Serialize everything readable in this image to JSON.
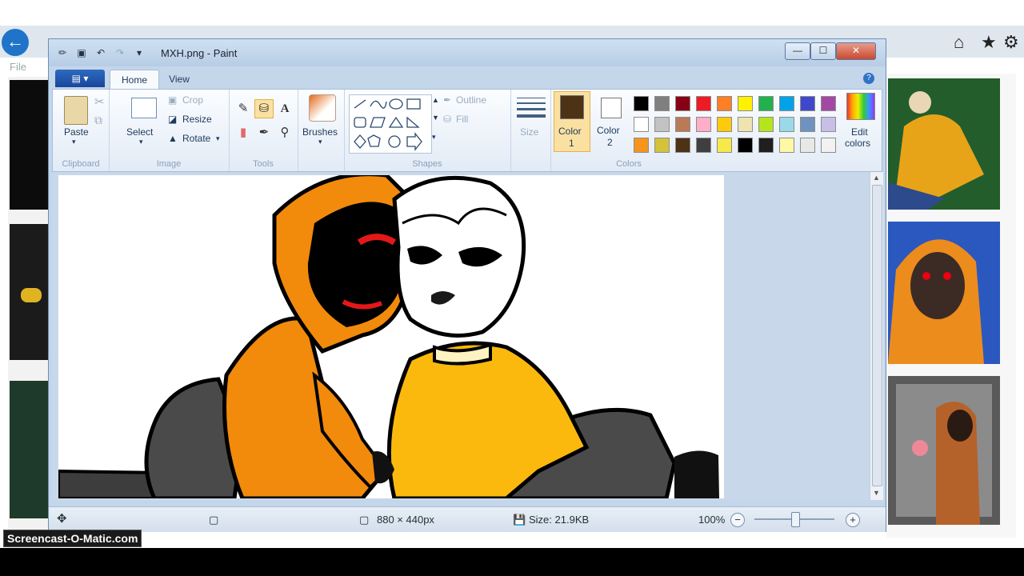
{
  "watermark": "Screencast-O-Matic.com",
  "browser": {
    "file_menu": "File",
    "back_icon": "back-arrow-icon",
    "home_icon": "home-icon",
    "favorites_icon": "star-icon",
    "settings_icon": "gear-icon"
  },
  "window": {
    "title": "MXH.png - Paint",
    "controls": {
      "minimize": "—",
      "maximize": "☐",
      "close": "✕"
    }
  },
  "tabs": [
    {
      "label": "Home",
      "active": true
    },
    {
      "label": "View",
      "active": false
    }
  ],
  "ribbon": {
    "clipboard": {
      "paste": "Paste",
      "group": "Clipboard"
    },
    "image": {
      "select": "Select",
      "crop": "Crop",
      "resize": "Resize",
      "rotate": "Rotate",
      "group": "Image"
    },
    "tools": {
      "group": "Tools"
    },
    "brushes": {
      "label": "Brushes"
    },
    "shapes": {
      "outline": "Outline",
      "fill": "Fill",
      "group": "Shapes"
    },
    "size": {
      "label": "Size"
    },
    "color1": {
      "label": "Color 1",
      "line1": "Color",
      "line2": "1",
      "value": "#4d3216"
    },
    "color2": {
      "label": "Color 2",
      "line1": "Color",
      "line2": "2",
      "value": "#ffffff"
    },
    "colors_group": "Colors",
    "edit_colors": {
      "line1": "Edit",
      "line2": "colors"
    },
    "palette": [
      [
        "#000000",
        "#7f7f7f",
        "#880015",
        "#ed1c24",
        "#ff7f27",
        "#fff200",
        "#22b14c",
        "#00a2e8",
        "#3f48cc",
        "#a349a4"
      ],
      [
        "#ffffff",
        "#c3c3c3",
        "#b97a57",
        "#ffaec9",
        "#ffc90e",
        "#efe4b0",
        "#b5e61d",
        "#99d9ea",
        "#7092be",
        "#c8bfe7"
      ],
      [
        "#f7941d",
        "#d4c23a",
        "#4d3216",
        "#3f3f3f",
        "#f6e94a",
        "#000000",
        "#1f1f1f",
        "#fff9a6",
        "#e8e8e8",
        "#f2f2f2"
      ]
    ]
  },
  "status": {
    "dimensions": "880 × 440px",
    "size": "Size: 21.9KB",
    "zoom": "100%"
  }
}
